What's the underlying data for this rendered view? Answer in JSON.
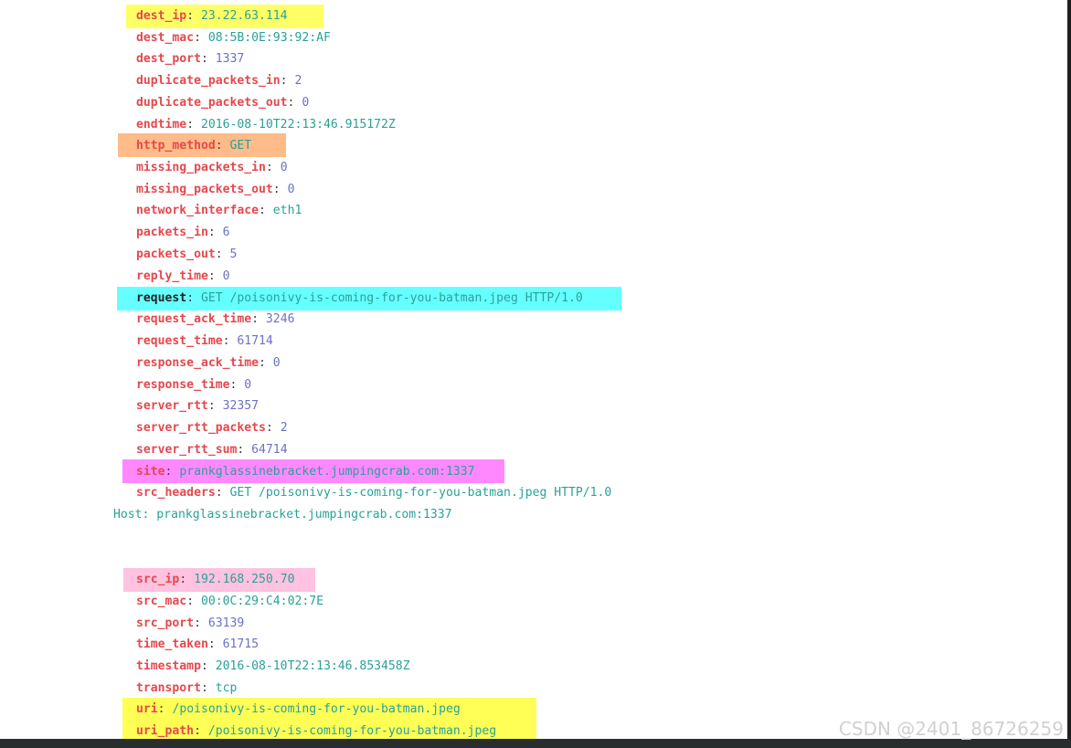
{
  "fields": [
    {
      "key": "dest_ip",
      "value": "23.22.63.114"
    },
    {
      "key": "dest_mac",
      "value": "08:5B:0E:93:92:AF"
    },
    {
      "key": "dest_port",
      "value": "1337"
    },
    {
      "key": "duplicate_packets_in",
      "value": "2"
    },
    {
      "key": "duplicate_packets_out",
      "value": "0"
    },
    {
      "key": "endtime",
      "value": "2016-08-10T22:13:46.915172Z"
    },
    {
      "key": "http_method",
      "value": "GET"
    },
    {
      "key": "missing_packets_in",
      "value": "0"
    },
    {
      "key": "missing_packets_out",
      "value": "0"
    },
    {
      "key": "network_interface",
      "value": "eth1"
    },
    {
      "key": "packets_in",
      "value": "6"
    },
    {
      "key": "packets_out",
      "value": "5"
    },
    {
      "key": "reply_time",
      "value": "0"
    },
    {
      "key": "request",
      "value": "GET /poisonivy-is-coming-for-you-batman.jpeg HTTP/1.0"
    },
    {
      "key": "request_ack_time",
      "value": "3246"
    },
    {
      "key": "request_time",
      "value": "61714"
    },
    {
      "key": "response_ack_time",
      "value": "0"
    },
    {
      "key": "response_time",
      "value": "0"
    },
    {
      "key": "server_rtt",
      "value": "32357"
    },
    {
      "key": "server_rtt_packets",
      "value": "2"
    },
    {
      "key": "server_rtt_sum",
      "value": "64714"
    },
    {
      "key": "site",
      "value": "prankglassinebracket.jumpingcrab.com:1337"
    },
    {
      "key": "src_headers",
      "value": "GET /poisonivy-is-coming-for-you-batman.jpeg HTTP/1.0"
    },
    {
      "key": "src_ip",
      "value": "192.168.250.70"
    },
    {
      "key": "src_mac",
      "value": "00:0C:29:C4:02:7E"
    },
    {
      "key": "src_port",
      "value": "63139"
    },
    {
      "key": "time_taken",
      "value": "61715"
    },
    {
      "key": "timestamp",
      "value": "2016-08-10T22:13:46.853458Z"
    },
    {
      "key": "transport",
      "value": "tcp"
    },
    {
      "key": "uri",
      "value": "/poisonivy-is-coming-for-you-batman.jpeg"
    },
    {
      "key": "uri_path",
      "value": "/poisonivy-is-coming-for-you-batman.jpeg"
    }
  ],
  "src_headers_continuation": "Host: prankglassinebracket.jumpingcrab.com:1337",
  "highlighted_keys": {
    "dest_ip": "#ffff66",
    "http_method": "#ffbb88",
    "request": "#66ffff",
    "site": "#ff88ff",
    "src_ip": "#ffc2e0",
    "uri": "#ffff55",
    "uri_path": "#ffff55"
  },
  "colors": {
    "key": "#e5484d",
    "string_value": "#2aa198",
    "number_value": "#6c71c4",
    "background": "#ffffff",
    "frame": "#1e1e1e"
  },
  "watermark": "CSDN @2401_86726259"
}
